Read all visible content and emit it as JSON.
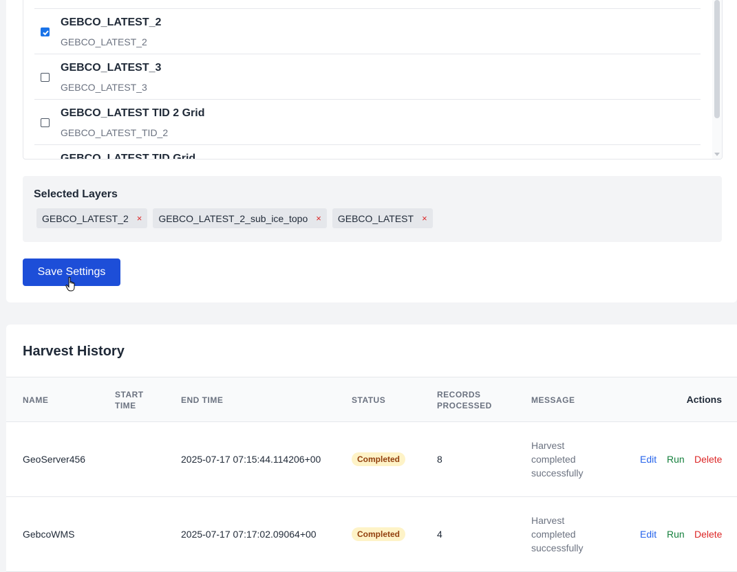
{
  "layers": [
    {
      "title": "GEBCO_LATEST_2",
      "subtitle": "GEBCO_LATEST_2",
      "checked": true
    },
    {
      "title": "GEBCO_LATEST_3",
      "subtitle": "GEBCO_LATEST_3",
      "checked": false
    },
    {
      "title": "GEBCO_LATEST TID 2 Grid",
      "subtitle": "GEBCO_LATEST_TID_2",
      "checked": false
    },
    {
      "title": "GEBCO_LATEST TID Grid",
      "subtitle": "",
      "checked": false
    }
  ],
  "selected_layers": {
    "heading": "Selected Layers",
    "chips": [
      {
        "label": "GEBCO_LATEST_2",
        "remove": "×"
      },
      {
        "label": "GEBCO_LATEST_2_sub_ice_topo",
        "remove": "×"
      },
      {
        "label": "GEBCO_LATEST",
        "remove": "×"
      }
    ]
  },
  "save_button": "Save Settings",
  "harvest_history": {
    "title": "Harvest History",
    "columns": {
      "name": "NAME",
      "start_time": "START\nTIME",
      "end_time": "END TIME",
      "status": "STATUS",
      "records": "RECORDS\nPROCESSED",
      "message": "MESSAGE",
      "actions": "Actions"
    },
    "rows": [
      {
        "name": "GeoServer456",
        "start_time": "",
        "end_time": "2025-07-17 07:15:44.114206+00",
        "status": "Completed",
        "records": "8",
        "message": "Harvest completed successfully",
        "edit": "Edit",
        "run": "Run",
        "delete": "Delete"
      },
      {
        "name": "GebcoWMS",
        "start_time": "",
        "end_time": "2025-07-17 07:17:02.09064+00",
        "status": "Completed",
        "records": "4",
        "message": "Harvest completed successfully",
        "edit": "Edit",
        "run": "Run",
        "delete": "Delete"
      }
    ]
  },
  "colors": {
    "primary": "#1d4ed8",
    "badge_bg": "#fef3c7",
    "badge_text": "#92400e",
    "edit": "#2563eb",
    "run": "#15803d",
    "delete": "#dc2626"
  }
}
